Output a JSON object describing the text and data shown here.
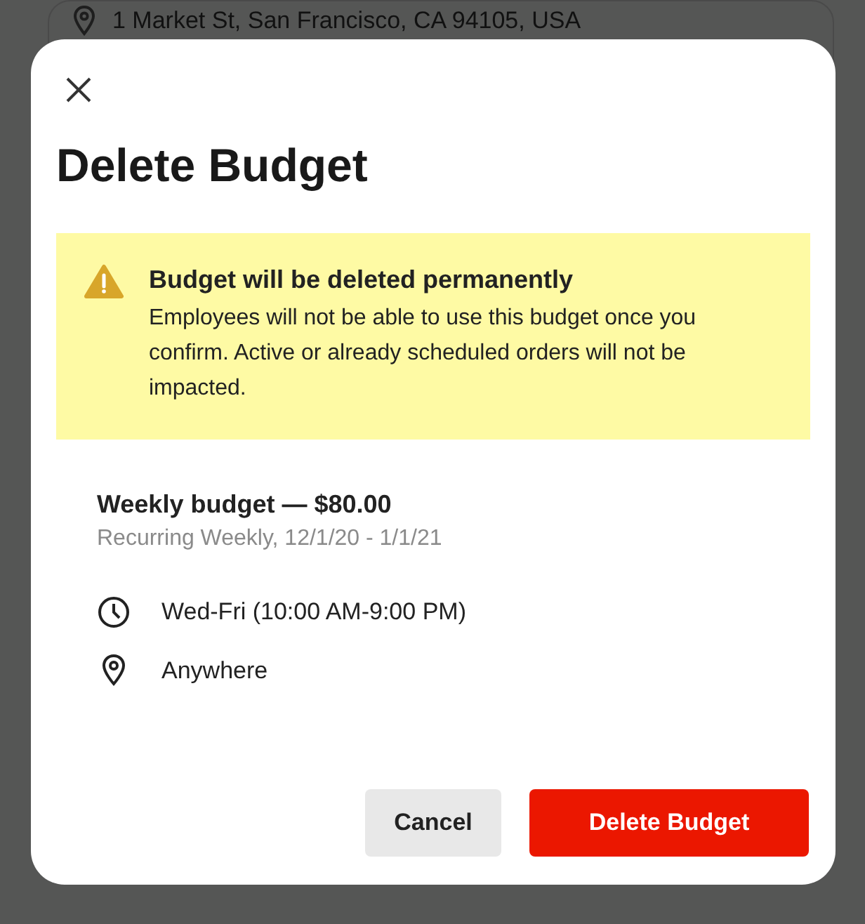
{
  "background": {
    "address": "1 Market St, San Francisco, CA 94105, USA"
  },
  "dialog": {
    "title": "Delete Budget",
    "alert": {
      "title": "Budget will be deleted permanently",
      "message": "Employees will not be able to use this budget once you confirm. Active or already scheduled orders will not be impacted."
    },
    "budget": {
      "name": "Weekly budget — $80.00",
      "schedule": "Recurring Weekly, 12/1/20 - 1/1/21",
      "details": [
        {
          "kind": "time",
          "text": "Wed-Fri (10:00 AM-9:00 PM)"
        },
        {
          "kind": "location",
          "text": "Anywhere"
        }
      ]
    },
    "buttons": [
      {
        "kind": "secondary",
        "label": "Cancel"
      },
      {
        "kind": "primary",
        "label": "Delete Budget"
      }
    ]
  }
}
